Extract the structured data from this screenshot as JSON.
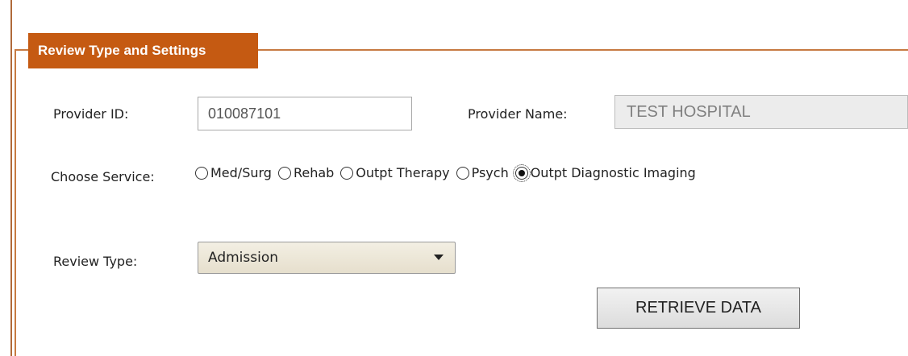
{
  "panel": {
    "legend": "Review Type and Settings"
  },
  "provider": {
    "id_label": "Provider ID:",
    "id_value": "010087101",
    "name_label": "Provider Name:",
    "name_value": "TEST HOSPITAL"
  },
  "service": {
    "label": "Choose Service:",
    "options": [
      {
        "label": "Med/Surg",
        "selected": false
      },
      {
        "label": "Rehab",
        "selected": false
      },
      {
        "label": "Outpt Therapy",
        "selected": false
      },
      {
        "label": "Psych",
        "selected": false
      },
      {
        "label": "Outpt Diagnostic Imaging",
        "selected": true
      }
    ]
  },
  "review_type": {
    "label": "Review Type:",
    "selected": "Admission"
  },
  "actions": {
    "retrieve_label": "RETRIEVE DATA"
  },
  "colors": {
    "legend_bg": "#c55a12",
    "border": "#c77a42"
  }
}
